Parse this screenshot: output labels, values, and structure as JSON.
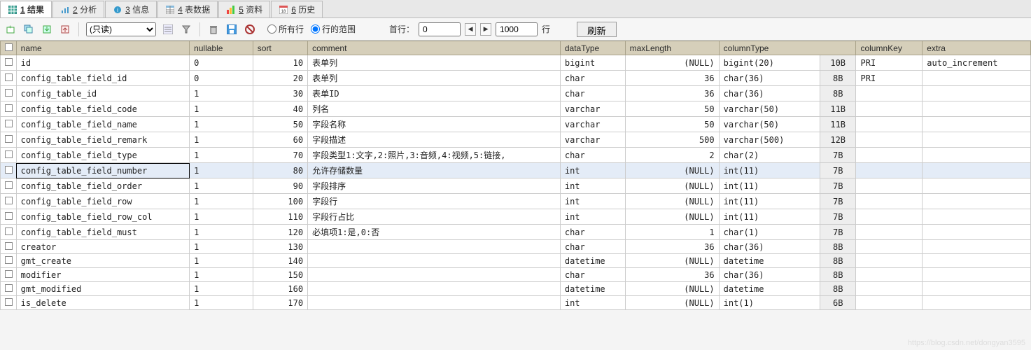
{
  "tabs": [
    {
      "num": "1",
      "label": "结果",
      "icon": "grid-green"
    },
    {
      "num": "2",
      "label": "分析",
      "icon": "chart"
    },
    {
      "num": "3",
      "label": "信息",
      "icon": "info"
    },
    {
      "num": "4",
      "label": "表数据",
      "icon": "table"
    },
    {
      "num": "5",
      "label": "资料",
      "icon": "stats"
    },
    {
      "num": "6",
      "label": "历史",
      "icon": "calendar"
    }
  ],
  "toolbar": {
    "mode": "(只读)",
    "radio_all": "所有行",
    "radio_range": "行的范围",
    "first_row_label": "首行：",
    "first_row_val": "0",
    "limit_val": "1000",
    "row_suffix": "行",
    "refresh": "刷新"
  },
  "columns": {
    "c0": "",
    "name": "name",
    "nullable": "nullable",
    "sort": "sort",
    "comment": "comment",
    "dataType": "dataType",
    "maxLength": "maxLength",
    "columnType": "columnType",
    "ctSize": "",
    "columnKey": "columnKey",
    "extra": "extra"
  },
  "rows": [
    {
      "name": "id",
      "nullable": "0",
      "sort": "10",
      "comment": "表单列",
      "dataType": "bigint",
      "maxLength": "(NULL)",
      "columnType": "bigint(20)",
      "ctSize": "10B",
      "columnKey": "PRI",
      "extra": "auto_increment"
    },
    {
      "name": "config_table_field_id",
      "nullable": "0",
      "sort": "20",
      "comment": "表单列",
      "dataType": "char",
      "maxLength": "36",
      "columnType": "char(36)",
      "ctSize": "8B",
      "columnKey": "PRI",
      "extra": ""
    },
    {
      "name": "config_table_id",
      "nullable": "1",
      "sort": "30",
      "comment": "表单ID",
      "dataType": "char",
      "maxLength": "36",
      "columnType": "char(36)",
      "ctSize": "8B",
      "columnKey": "",
      "extra": ""
    },
    {
      "name": "config_table_field_code",
      "nullable": "1",
      "sort": "40",
      "comment": "列名",
      "dataType": "varchar",
      "maxLength": "50",
      "columnType": "varchar(50)",
      "ctSize": "11B",
      "columnKey": "",
      "extra": ""
    },
    {
      "name": "config_table_field_name",
      "nullable": "1",
      "sort": "50",
      "comment": "字段名称",
      "dataType": "varchar",
      "maxLength": "50",
      "columnType": "varchar(50)",
      "ctSize": "11B",
      "columnKey": "",
      "extra": ""
    },
    {
      "name": "config_table_field_remark",
      "nullable": "1",
      "sort": "60",
      "comment": "字段描述",
      "dataType": "varchar",
      "maxLength": "500",
      "columnType": "varchar(500)",
      "ctSize": "12B",
      "columnKey": "",
      "extra": ""
    },
    {
      "name": "config_table_field_type",
      "nullable": "1",
      "sort": "70",
      "comment": "字段类型1:文字,2:照片,3:音频,4:视频,5:链接,",
      "dataType": "char",
      "maxLength": "2",
      "columnType": "char(2)",
      "ctSize": "7B",
      "columnKey": "",
      "extra": ""
    },
    {
      "name": "config_table_field_number",
      "nullable": "1",
      "sort": "80",
      "comment": "允许存储数量",
      "dataType": "int",
      "maxLength": "(NULL)",
      "columnType": "int(11)",
      "ctSize": "7B",
      "columnKey": "",
      "extra": "",
      "selected": true
    },
    {
      "name": "config_table_field_order",
      "nullable": "1",
      "sort": "90",
      "comment": "字段排序",
      "dataType": "int",
      "maxLength": "(NULL)",
      "columnType": "int(11)",
      "ctSize": "7B",
      "columnKey": "",
      "extra": ""
    },
    {
      "name": "config_table_field_row",
      "nullable": "1",
      "sort": "100",
      "comment": "字段行",
      "dataType": "int",
      "maxLength": "(NULL)",
      "columnType": "int(11)",
      "ctSize": "7B",
      "columnKey": "",
      "extra": ""
    },
    {
      "name": "config_table_field_row_col",
      "nullable": "1",
      "sort": "110",
      "comment": "字段行占比",
      "dataType": "int",
      "maxLength": "(NULL)",
      "columnType": "int(11)",
      "ctSize": "7B",
      "columnKey": "",
      "extra": ""
    },
    {
      "name": "config_table_field_must",
      "nullable": "1",
      "sort": "120",
      "comment": "必填项1:是,0:否",
      "dataType": "char",
      "maxLength": "1",
      "columnType": "char(1)",
      "ctSize": "7B",
      "columnKey": "",
      "extra": ""
    },
    {
      "name": "creator",
      "nullable": "1",
      "sort": "130",
      "comment": "",
      "dataType": "char",
      "maxLength": "36",
      "columnType": "char(36)",
      "ctSize": "8B",
      "columnKey": "",
      "extra": ""
    },
    {
      "name": "gmt_create",
      "nullable": "1",
      "sort": "140",
      "comment": "",
      "dataType": "datetime",
      "maxLength": "(NULL)",
      "columnType": "datetime",
      "ctSize": "8B",
      "columnKey": "",
      "extra": ""
    },
    {
      "name": "modifier",
      "nullable": "1",
      "sort": "150",
      "comment": "",
      "dataType": "char",
      "maxLength": "36",
      "columnType": "char(36)",
      "ctSize": "8B",
      "columnKey": "",
      "extra": ""
    },
    {
      "name": "gmt_modified",
      "nullable": "1",
      "sort": "160",
      "comment": "",
      "dataType": "datetime",
      "maxLength": "(NULL)",
      "columnType": "datetime",
      "ctSize": "8B",
      "columnKey": "",
      "extra": ""
    },
    {
      "name": "is_delete",
      "nullable": "1",
      "sort": "170",
      "comment": "",
      "dataType": "int",
      "maxLength": "(NULL)",
      "columnType": "int(1)",
      "ctSize": "6B",
      "columnKey": "",
      "extra": ""
    }
  ],
  "watermark": "https://blog.csdn.net/dongyan3595"
}
